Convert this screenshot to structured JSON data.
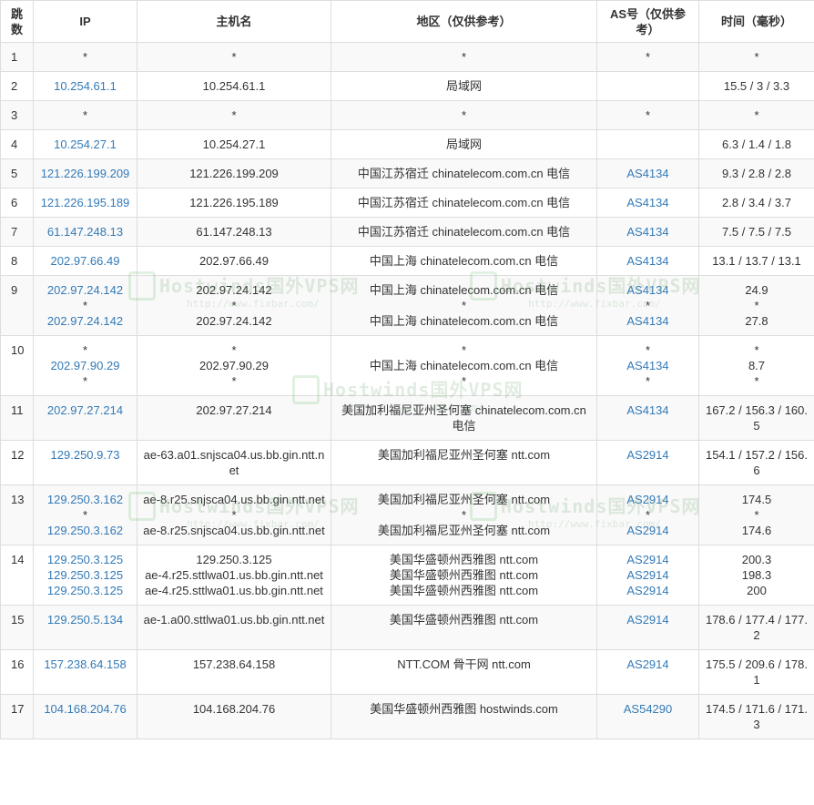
{
  "headers": {
    "hop": "跳数",
    "ip": "IP",
    "host": "主机名",
    "region": "地区（仅供参考）",
    "as": "AS号（仅供参考）",
    "time": "时间（毫秒）"
  },
  "watermark": {
    "text": "Hostwinds国外VPS网",
    "url": "http://www.fixbar.com/"
  },
  "colors": {
    "link": "#337ab7",
    "border": "#dddddd",
    "stripe": "#f9f9f9"
  },
  "rows": [
    {
      "hop": "1",
      "ip": [
        "*"
      ],
      "host": [
        "*"
      ],
      "region": [
        "*"
      ],
      "as": [
        "*"
      ],
      "time": [
        "*"
      ]
    },
    {
      "hop": "2",
      "ip": [
        "10.254.61.1"
      ],
      "host": [
        "10.254.61.1"
      ],
      "region": [
        "局域网"
      ],
      "as": [
        ""
      ],
      "time": [
        "15.5 / 3 / 3.3"
      ]
    },
    {
      "hop": "3",
      "ip": [
        "*"
      ],
      "host": [
        "*"
      ],
      "region": [
        "*"
      ],
      "as": [
        "*"
      ],
      "time": [
        "*"
      ]
    },
    {
      "hop": "4",
      "ip": [
        "10.254.27.1"
      ],
      "host": [
        "10.254.27.1"
      ],
      "region": [
        "局域网"
      ],
      "as": [
        ""
      ],
      "time": [
        "6.3 / 1.4 / 1.8"
      ]
    },
    {
      "hop": "5",
      "ip": [
        "121.226.199.209"
      ],
      "host": [
        "121.226.199.209"
      ],
      "region": [
        "中国江苏宿迁 chinatelecom.com.cn 电信"
      ],
      "as": [
        "AS4134"
      ],
      "time": [
        "9.3 / 2.8 / 2.8"
      ]
    },
    {
      "hop": "6",
      "ip": [
        "121.226.195.189"
      ],
      "host": [
        "121.226.195.189"
      ],
      "region": [
        "中国江苏宿迁 chinatelecom.com.cn 电信"
      ],
      "as": [
        "AS4134"
      ],
      "time": [
        "2.8 / 3.4 / 3.7"
      ]
    },
    {
      "hop": "7",
      "ip": [
        "61.147.248.13"
      ],
      "host": [
        "61.147.248.13"
      ],
      "region": [
        "中国江苏宿迁 chinatelecom.com.cn 电信"
      ],
      "as": [
        "AS4134"
      ],
      "time": [
        "7.5 / 7.5 / 7.5"
      ]
    },
    {
      "hop": "8",
      "ip": [
        "202.97.66.49"
      ],
      "host": [
        "202.97.66.49"
      ],
      "region": [
        "中国上海 chinatelecom.com.cn 电信"
      ],
      "as": [
        "AS4134"
      ],
      "time": [
        "13.1 / 13.7 / 13.1"
      ]
    },
    {
      "hop": "9",
      "ip": [
        "202.97.24.142",
        "*",
        "202.97.24.142"
      ],
      "host": [
        "202.97.24.142",
        "*",
        "202.97.24.142"
      ],
      "region": [
        "中国上海 chinatelecom.com.cn 电信",
        "*",
        "中国上海 chinatelecom.com.cn 电信"
      ],
      "as": [
        "AS4134",
        "*",
        "AS4134"
      ],
      "time": [
        "24.9",
        "*",
        "27.8"
      ]
    },
    {
      "hop": "10",
      "ip": [
        "*",
        "202.97.90.29",
        "*"
      ],
      "host": [
        "*",
        "202.97.90.29",
        "*"
      ],
      "region": [
        "*",
        "中国上海 chinatelecom.com.cn 电信",
        "*"
      ],
      "as": [
        "*",
        "AS4134",
        "*"
      ],
      "time": [
        "*",
        "8.7",
        "*"
      ]
    },
    {
      "hop": "11",
      "ip": [
        "202.97.27.214"
      ],
      "host": [
        "202.97.27.214"
      ],
      "region": [
        "美国加利福尼亚州圣何塞 chinatelecom.com.cn 电信"
      ],
      "as": [
        "AS4134"
      ],
      "time": [
        "167.2 / 156.3 / 160.5"
      ]
    },
    {
      "hop": "12",
      "ip": [
        "129.250.9.73"
      ],
      "host": [
        "ae-63.a01.snjsca04.us.bb.gin.ntt.net"
      ],
      "region": [
        "美国加利福尼亚州圣何塞 ntt.com"
      ],
      "as": [
        "AS2914"
      ],
      "time": [
        "154.1 / 157.2 / 156.6"
      ]
    },
    {
      "hop": "13",
      "ip": [
        "129.250.3.162",
        "*",
        "129.250.3.162"
      ],
      "host": [
        "ae-8.r25.snjsca04.us.bb.gin.ntt.net",
        "*",
        "ae-8.r25.snjsca04.us.bb.gin.ntt.net"
      ],
      "region": [
        "美国加利福尼亚州圣何塞 ntt.com",
        "*",
        "美国加利福尼亚州圣何塞 ntt.com"
      ],
      "as": [
        "AS2914",
        "*",
        "AS2914"
      ],
      "time": [
        "174.5",
        "*",
        "174.6"
      ]
    },
    {
      "hop": "14",
      "ip": [
        "129.250.3.125",
        "129.250.3.125",
        "129.250.3.125"
      ],
      "host": [
        "129.250.3.125",
        "ae-4.r25.sttlwa01.us.bb.gin.ntt.net",
        "ae-4.r25.sttlwa01.us.bb.gin.ntt.net"
      ],
      "region": [
        "美国华盛顿州西雅图 ntt.com",
        "美国华盛顿州西雅图 ntt.com",
        "美国华盛顿州西雅图 ntt.com"
      ],
      "as": [
        "AS2914",
        "AS2914",
        "AS2914"
      ],
      "time": [
        "200.3",
        "198.3",
        "200"
      ]
    },
    {
      "hop": "15",
      "ip": [
        "129.250.5.134"
      ],
      "host": [
        "ae-1.a00.sttlwa01.us.bb.gin.ntt.net"
      ],
      "region": [
        "美国华盛顿州西雅图 ntt.com"
      ],
      "as": [
        "AS2914"
      ],
      "time": [
        "178.6 / 177.4 / 177.2"
      ]
    },
    {
      "hop": "16",
      "ip": [
        "157.238.64.158"
      ],
      "host": [
        "157.238.64.158"
      ],
      "region": [
        "NTT.COM 骨干网 ntt.com"
      ],
      "as": [
        "AS2914"
      ],
      "time": [
        "175.5 / 209.6 / 178.1"
      ]
    },
    {
      "hop": "17",
      "ip": [
        "104.168.204.76"
      ],
      "host": [
        "104.168.204.76"
      ],
      "region": [
        "美国华盛顿州西雅图 hostwinds.com"
      ],
      "as": [
        "AS54290"
      ],
      "time": [
        "174.5 / 171.6 / 171.3"
      ]
    }
  ]
}
